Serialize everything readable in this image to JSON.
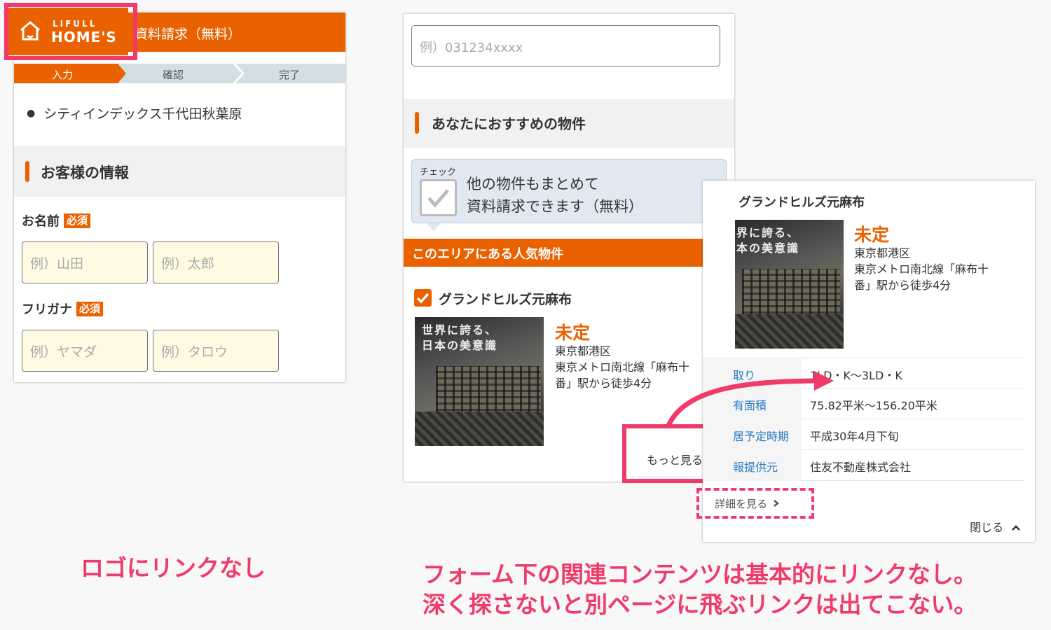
{
  "header": {
    "logo_small": "LIFULL",
    "logo_big": "HOME'S",
    "title": "資料請求（無料）"
  },
  "steps": [
    "入力",
    "確認",
    "完了"
  ],
  "property_list": [
    "シティインデックス千代田秋葉原"
  ],
  "customer_section": {
    "title": "お客様の情報",
    "name_label": "お名前",
    "required_badge": "必須",
    "last_name_placeholder": "例）山田",
    "first_name_placeholder": "例）太郎",
    "kana_label": "フリガナ",
    "last_kana_placeholder": "例）ヤマダ",
    "first_kana_placeholder": "例）タロウ"
  },
  "middle": {
    "phone_placeholder": "例）031234xxxx",
    "recommend_title": "あなたにおすすめの物件",
    "check_small": "チェック",
    "check_line1": "他の物件もまとめて",
    "check_line2": "資料請求できます（無料）",
    "area_bar": "このエリアにある人気物件",
    "property": {
      "name": "グランドヒルズ元麻布",
      "price": "未定",
      "address": "東京都港区",
      "access_line1": "東京メトロ南北線「麻布十",
      "access_line2": "番」駅から徒歩4分",
      "photo_text1": "世界に誇る、",
      "photo_text2": "日本の美意識"
    },
    "more_label": "もっと見る"
  },
  "detail": {
    "name": "グランドヒルズ元麻布",
    "photo_text1": "界に誇る、",
    "photo_text2": "本の美意識",
    "price": "未定",
    "address": "東京都港区",
    "access_line1": "東京メトロ南北線「麻布十",
    "access_line2": "番」駅から徒歩4分",
    "rows": [
      {
        "key": "取り",
        "value": "1LD・K〜3LD・K"
      },
      {
        "key": "有面積",
        "value": "75.82平米〜156.20平米"
      },
      {
        "key": "居予定時期",
        "value": "平成30年4月下旬"
      },
      {
        "key": "報提供元",
        "value": "住友不動産株式会社"
      }
    ],
    "see_detail": "詳細を見る",
    "close": "閉じる"
  },
  "annotations": {
    "caption_left": "ロゴにリンクなし",
    "caption_right_line1": "フォーム下の関連コンテンツは基本的にリンクなし。",
    "caption_right_line2": "深く探さないと別ページに飛ぶリンクは出てこない。"
  },
  "colors": {
    "brand_orange": "#ea6100",
    "highlight_pink": "#f03b6a",
    "input_yellow": "#fffbe3",
    "link_blue": "#2a7cc7"
  }
}
